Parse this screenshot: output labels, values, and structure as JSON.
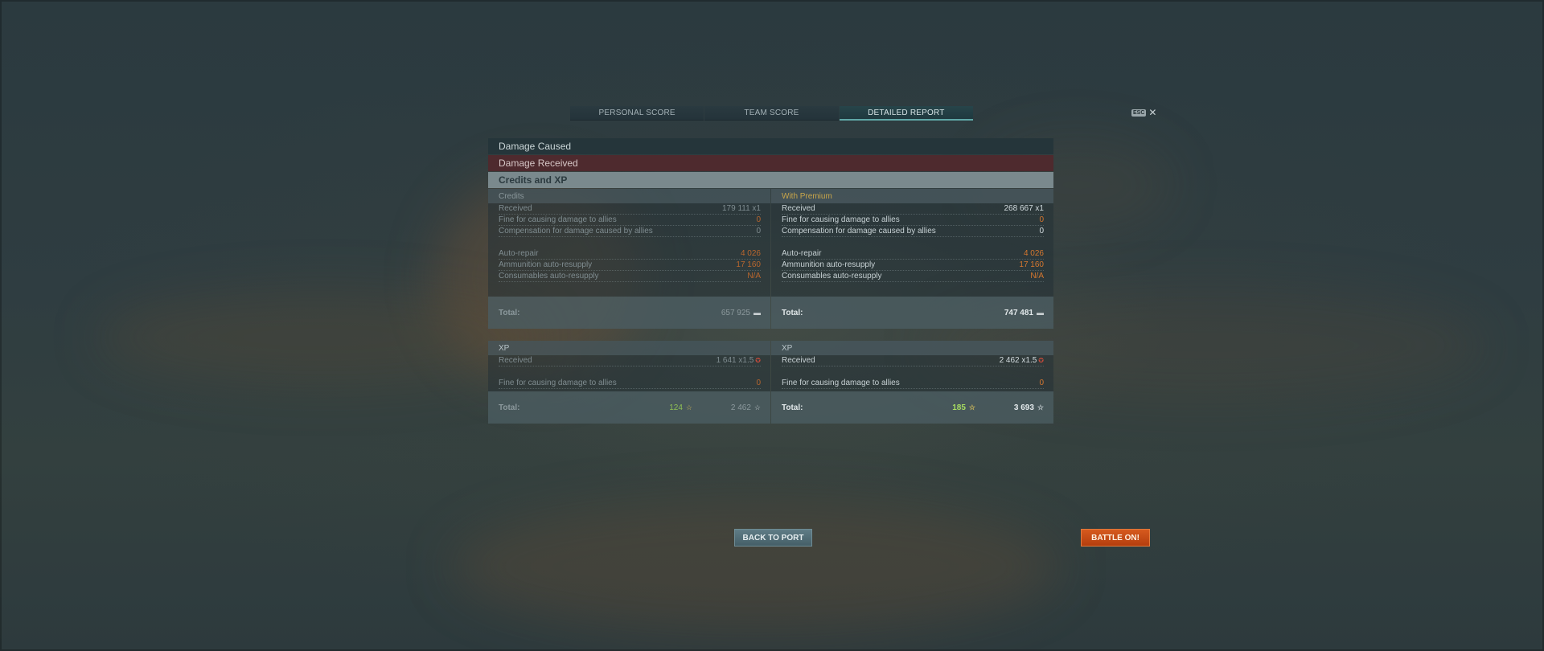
{
  "tabs": [
    {
      "label": "PERSONAL SCORE",
      "active": false
    },
    {
      "label": "TEAM SCORE",
      "active": false
    },
    {
      "label": "DETAILED REPORT",
      "active": true
    }
  ],
  "close": {
    "key_label": "ESC",
    "icon": "close-icon"
  },
  "sections": {
    "damage_caused": "Damage Caused",
    "damage_received": "Damage Received",
    "credits_xp": "Credits and XP"
  },
  "credits": {
    "left": {
      "title": "Credits",
      "received_label": "Received",
      "received_value": "179 111 x1",
      "fine_label": "Fine for causing damage to allies",
      "fine_value": "0",
      "comp_label": "Compensation for damage caused by allies",
      "comp_value": "0",
      "autorepair_label": "Auto-repair",
      "autorepair_value": "4 026",
      "ammo_label": "Ammunition auto-resupply",
      "ammo_value": "17 160",
      "consumables_label": "Consumables auto-resupply",
      "consumables_value": "N/A",
      "total_label": "Total:",
      "total_value": "657 925"
    },
    "right": {
      "title": "With Premium",
      "received_label": "Received",
      "received_value": "268 667 x1",
      "fine_label": "Fine for causing damage to allies",
      "fine_value": "0",
      "comp_label": "Compensation for damage caused by allies",
      "comp_value": "0",
      "autorepair_label": "Auto-repair",
      "autorepair_value": "4 026",
      "ammo_label": "Ammunition auto-resupply",
      "ammo_value": "17 160",
      "consumables_label": "Consumables auto-resupply",
      "consumables_value": "N/A",
      "total_label": "Total:",
      "total_value": "747 481"
    }
  },
  "xp": {
    "left": {
      "title": "XP",
      "received_label": "Received",
      "received_value": "1 641 x1.5",
      "fine_label": "Fine for causing damage to allies",
      "fine_value": "0",
      "total_label": "Total:",
      "total_free": "124",
      "total_xp": "2 462"
    },
    "right": {
      "title": "XP",
      "received_label": "Received",
      "received_value": "2 462 x1.5",
      "fine_label": "Fine for causing damage to allies",
      "fine_value": "0",
      "total_label": "Total:",
      "total_free": "185",
      "total_xp": "3 693"
    }
  },
  "buttons": {
    "back": "BACK TO PORT",
    "battle": "BATTLE ON!"
  },
  "colors": {
    "accent_tab": "#5fa8a7",
    "premium": "#c9a64a",
    "penalty": "#d5772f",
    "free_xp": "#a7dc61",
    "battle_button": "#c94b15"
  }
}
